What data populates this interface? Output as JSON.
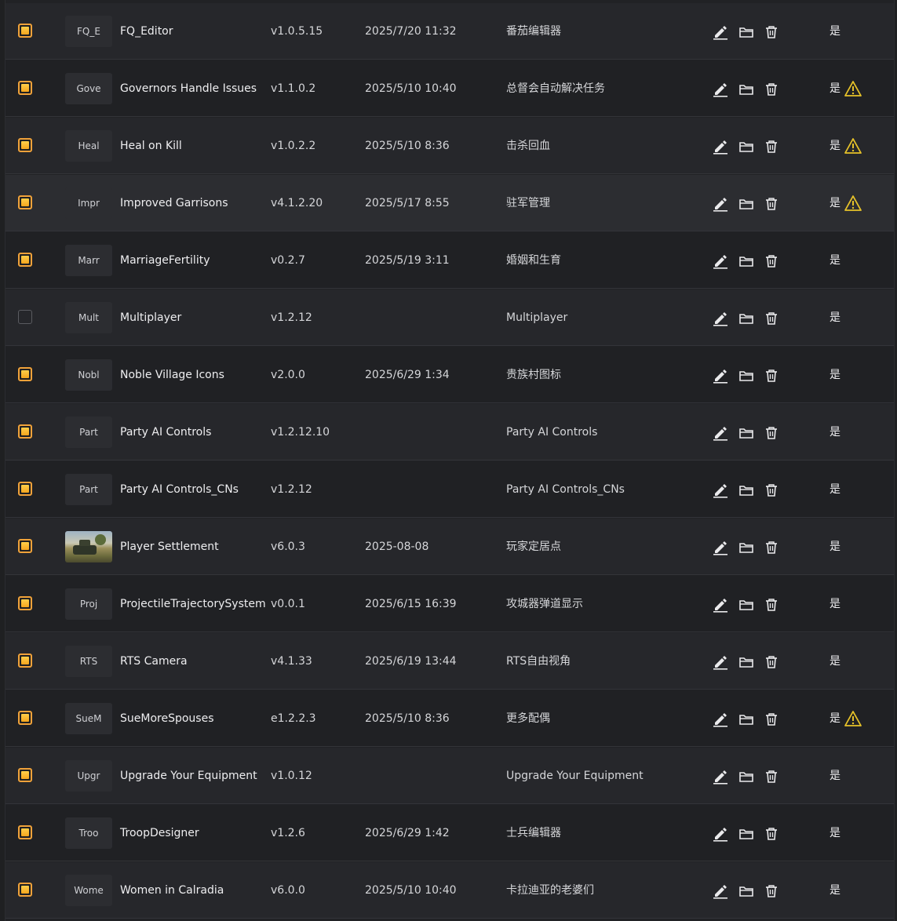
{
  "rows": [
    {
      "checked": true,
      "thumb": "FQ_E",
      "thumb_image": false,
      "name": "FQ_Editor",
      "version": "v1.0.5.15",
      "date": "2025/7/20 11:32",
      "description": "番茄编辑器",
      "status": "是",
      "warning": false
    },
    {
      "checked": true,
      "thumb": "Gove",
      "thumb_image": false,
      "name": "Governors Handle Issues",
      "version": "v1.1.0.2",
      "date": "2025/5/10 10:40",
      "description": "总督会自动解决任务",
      "status": "是",
      "warning": true
    },
    {
      "checked": true,
      "thumb": "Heal",
      "thumb_image": false,
      "name": "Heal on Kill",
      "version": "v1.0.2.2",
      "date": "2025/5/10 8:36",
      "description": "击杀回血",
      "status": "是",
      "warning": true
    },
    {
      "checked": true,
      "thumb": "Impr",
      "thumb_image": false,
      "name": "Improved Garrisons",
      "version": "v4.1.2.20",
      "date": "2025/5/17 8:55",
      "description": "驻军管理",
      "status": "是",
      "warning": true
    },
    {
      "checked": true,
      "thumb": "Marr",
      "thumb_image": false,
      "name": "MarriageFertility",
      "version": "v0.2.7",
      "date": "2025/5/19 3:11",
      "description": "婚姻和生育",
      "status": "是",
      "warning": false
    },
    {
      "checked": false,
      "thumb": "Mult",
      "thumb_image": false,
      "name": "Multiplayer",
      "version": "v1.2.12",
      "date": "",
      "description": "Multiplayer",
      "status": "是",
      "warning": false
    },
    {
      "checked": true,
      "thumb": "Nobl",
      "thumb_image": false,
      "name": "Noble Village Icons",
      "version": "v2.0.0",
      "date": "2025/6/29 1:34",
      "description": "贵族村图标",
      "status": "是",
      "warning": false
    },
    {
      "checked": true,
      "thumb": "Part",
      "thumb_image": false,
      "name": "Party AI Controls",
      "version": "v1.2.12.10",
      "date": "",
      "description": "Party AI Controls",
      "status": "是",
      "warning": false
    },
    {
      "checked": true,
      "thumb": "Part",
      "thumb_image": false,
      "name": "Party AI Controls_CNs",
      "version": "v1.2.12",
      "date": "",
      "description": "Party AI Controls_CNs",
      "status": "是",
      "warning": false
    },
    {
      "checked": true,
      "thumb": "",
      "thumb_image": true,
      "name": "Player Settlement",
      "version": "v6.0.3",
      "date": "2025-08-08",
      "description": "玩家定居点",
      "status": "是",
      "warning": false
    },
    {
      "checked": true,
      "thumb": "Proj",
      "thumb_image": false,
      "name": "ProjectileTrajectorySystem",
      "version": "v0.0.1",
      "date": "2025/6/15 16:39",
      "description": "攻城器弹道显示",
      "status": "是",
      "warning": false
    },
    {
      "checked": true,
      "thumb": "RTS",
      "thumb_image": false,
      "name": "RTS Camera",
      "version": "v4.1.33",
      "date": "2025/6/19 13:44",
      "description": "RTS自由视角",
      "status": "是",
      "warning": false
    },
    {
      "checked": true,
      "thumb": "SueM",
      "thumb_image": false,
      "name": "SueMoreSpouses",
      "version": "e1.2.2.3",
      "date": "2025/5/10 8:36",
      "description": "更多配偶",
      "status": "是",
      "warning": true
    },
    {
      "checked": true,
      "thumb": "Upgr",
      "thumb_image": false,
      "name": "Upgrade Your Equipment",
      "version": "v1.0.12",
      "date": "",
      "description": "Upgrade Your Equipment",
      "status": "是",
      "warning": false
    },
    {
      "checked": true,
      "thumb": "Troo",
      "thumb_image": false,
      "name": "TroopDesigner",
      "version": "v1.2.6",
      "date": "2025/6/29 1:42",
      "description": "士兵编辑器",
      "status": "是",
      "warning": false
    },
    {
      "checked": true,
      "thumb": "Wome",
      "thumb_image": false,
      "name": "Women in Calradia",
      "version": "v6.0.0",
      "date": "2025/5/10 10:40",
      "description": "卡拉迪亚的老婆们",
      "status": "是",
      "warning": false
    }
  ],
  "icons": {
    "edit": "edit-icon",
    "folder": "folder-icon",
    "delete": "trash-icon",
    "warning": "warning-icon"
  },
  "colors": {
    "checkbox_accent": "#f4a51e",
    "warning": "#e6c229"
  }
}
